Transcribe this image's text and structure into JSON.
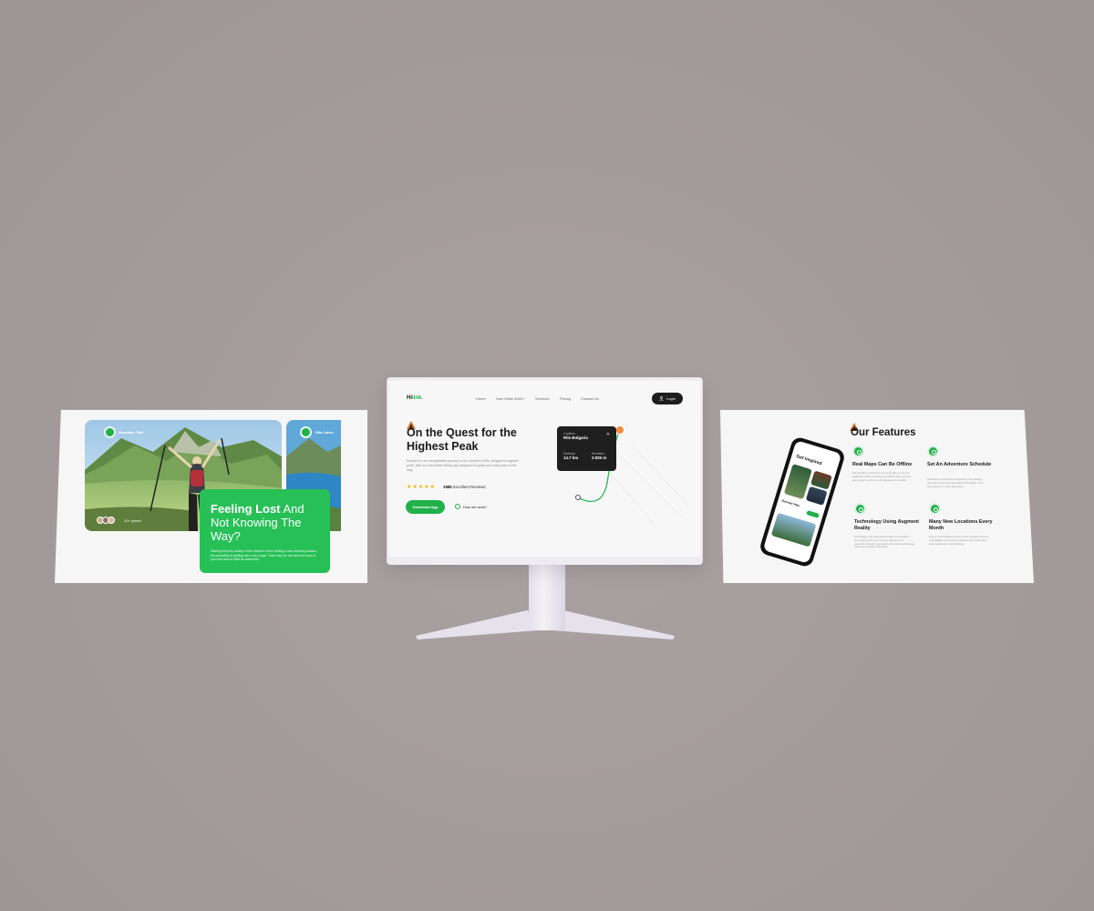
{
  "colors": {
    "background": "#a69d9d",
    "accent_green": "#22b04b",
    "dark_button": "#1e1e1e",
    "star": "#f5b301"
  },
  "left_panel": {
    "location_1": "Mountain Trail",
    "location_2": "Rila Lakes",
    "avatar_count": "10+ joined",
    "card_title_bold": "Feeling Lost",
    "card_title_rest": " And Not Knowing The Way?",
    "card_body": "Starting from the anxiety of the climbers when visiting a new climbing location, the possibility of getting lost is very large. That's why we are here for those of you who want to start an adventure."
  },
  "monitor": {
    "logo_main": "Hi",
    "logo_accent": "link.",
    "nav": [
      "Home",
      "How Hilink Work?",
      "Services",
      "Pricing",
      "Contact Us"
    ],
    "login_label": "Login",
    "login_icon": "user-icon",
    "camp_icon": "camp-icon",
    "hero_title": "On the Quest for the Highest Peak",
    "hero_desc": "Embark on an unforgettable journey to the summit of Rila, Bulgaria's majestic peak, with our innovative hiking app designed to guide you every step of the way.",
    "stars": "★★★★★",
    "reviews_bold": "198k",
    "reviews_rest": " Excellent Reviews",
    "download_label": "Download App",
    "how_label": "How we work?",
    "location_card": {
      "location_label": "Location",
      "location_value": "Rila Bulgaria",
      "close_icon": "close-icon",
      "distance_label": "Distance",
      "distance_value": "14.7 km",
      "elevation_label": "Elevation",
      "elevation_value": "2.925 m"
    }
  },
  "right_panel": {
    "title": "Our Features",
    "phone_title": "Get Inspired",
    "phone_subtitle": "Summer Hike",
    "features": [
      {
        "title": "Real Maps Can Be Offline",
        "desc": "We provide a solution for you to be able to use our application when climbing, yes offline maps you can use at any time there is no signal at the location",
        "icon": "map-icon"
      },
      {
        "title": "Set An Adventure Schedule",
        "desc": "Schedule an adventure with friends. On holidays, there are many interesting offers from Hilink. That way, there's no more discussion",
        "icon": "calendar-icon"
      },
      {
        "title": "Technology Using Augment Reality",
        "desc": "Technology uses augmented reality as a guide to your hiking trail in the forest to the top of the mountain. Already supported by the latest technology without an internet connection",
        "icon": "ar-icon"
      },
      {
        "title": "Many New Locations Every Month",
        "desc": "Lots of new locations every month, because we have a worldwide community of climbers who share their best experiences with climbing",
        "icon": "location-icon"
      }
    ]
  }
}
